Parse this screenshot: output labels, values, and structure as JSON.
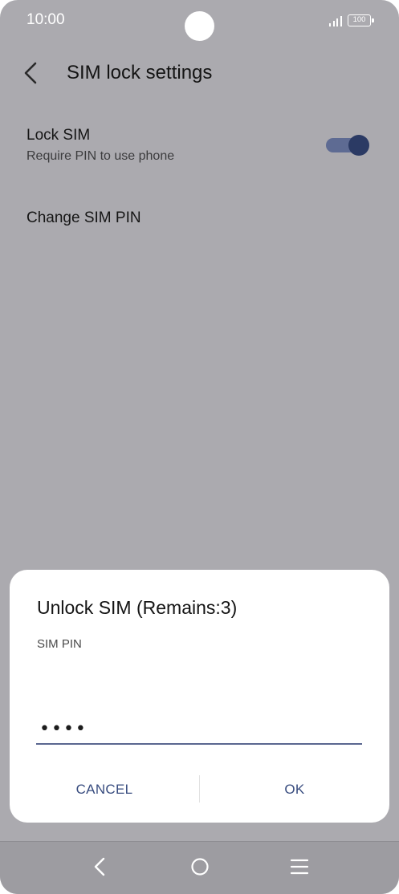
{
  "status_bar": {
    "time": "10:00",
    "battery": "100",
    "signal_icon": "signal-icon"
  },
  "header": {
    "title": "SIM lock settings",
    "back_icon": "back-arrow-icon"
  },
  "settings": {
    "lock_sim": {
      "title": "Lock SIM",
      "subtitle": "Require PIN to use phone",
      "toggle_on": true
    },
    "change_pin": {
      "title": "Change SIM PIN"
    }
  },
  "dialog": {
    "title": "Unlock SIM (Remains:3)",
    "field_label": "SIM PIN",
    "pin_value": "••••",
    "cancel_label": "CANCEL",
    "ok_label": "OK"
  },
  "nav_bar": {
    "icons": [
      "back-icon",
      "home-icon",
      "menu-icon"
    ]
  },
  "colors": {
    "scrim": "#abaaaf",
    "accent": "#384c7f",
    "toggle_thumb": "#2b3a64",
    "toggle_track": "#5e6b93"
  }
}
